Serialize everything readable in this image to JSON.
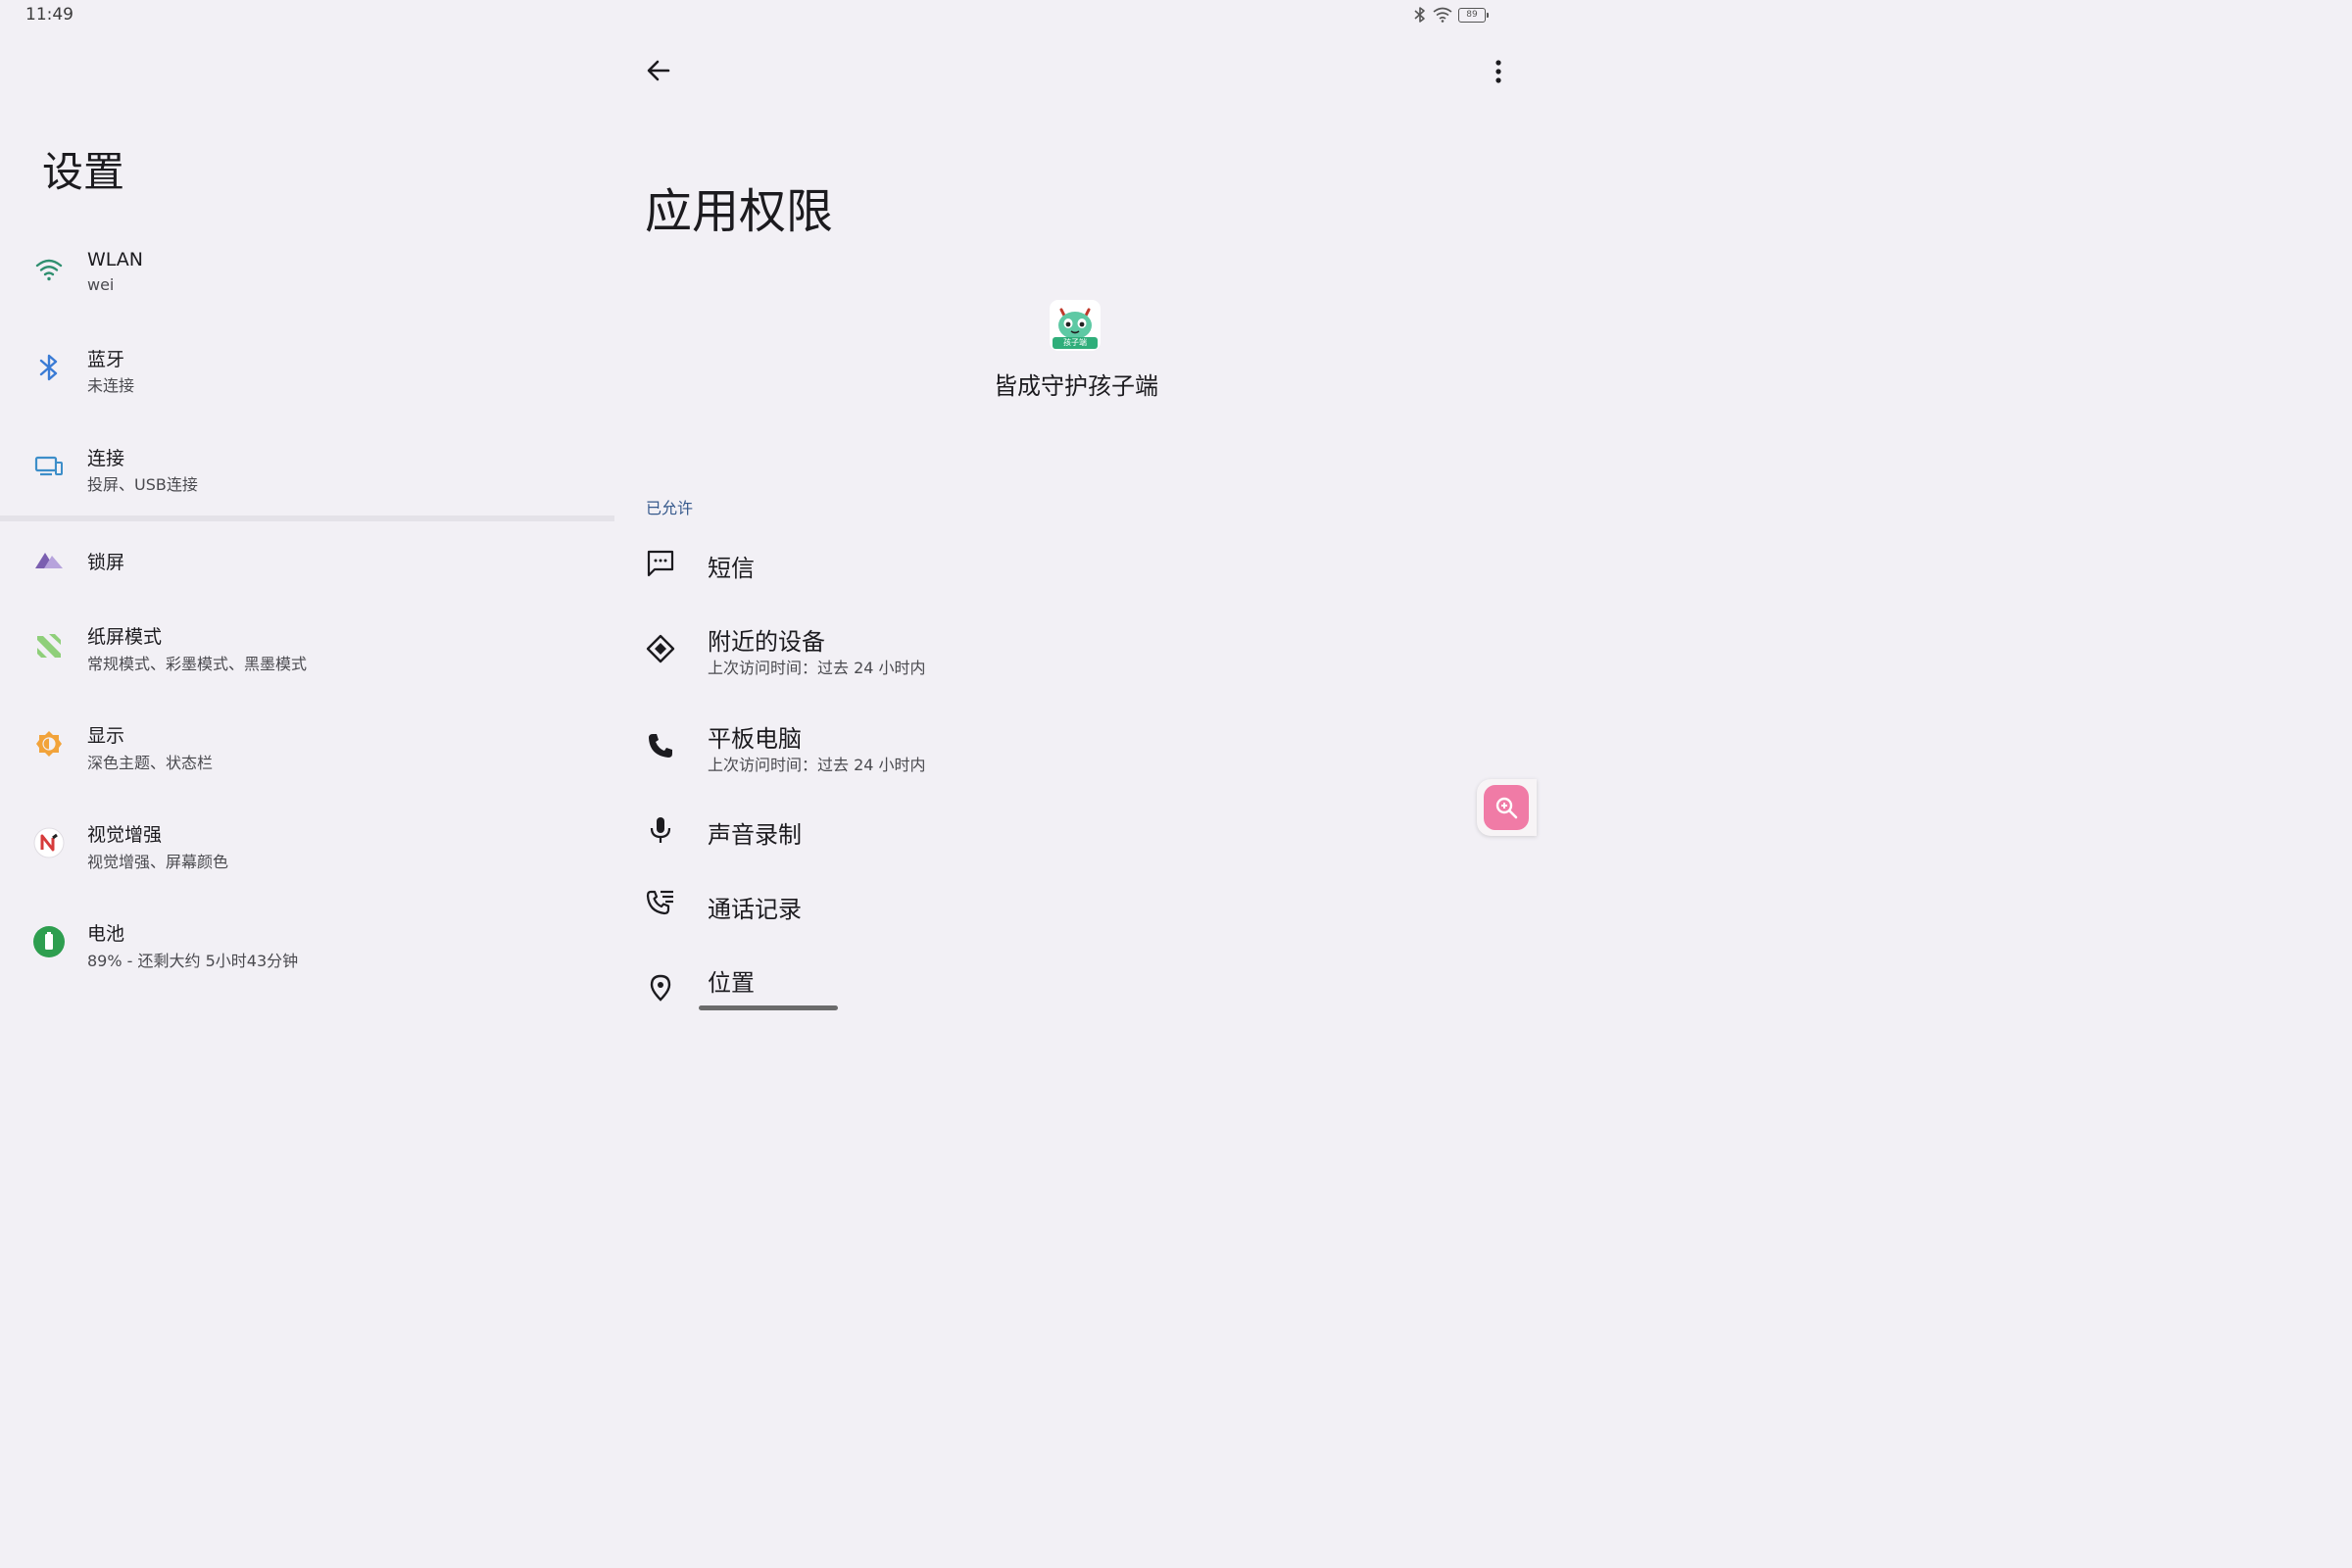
{
  "status_bar": {
    "time": "11:49",
    "battery_level": "89"
  },
  "settings": {
    "title": "设置",
    "items": [
      {
        "title": "WLAN",
        "subtitle": "wei",
        "icon": "wifi-icon"
      },
      {
        "title": "蓝牙",
        "subtitle": "未连接",
        "icon": "bluetooth-icon"
      },
      {
        "title": "连接",
        "subtitle": "投屏、USB连接",
        "icon": "devices-icon"
      },
      {
        "title": "锁屏",
        "subtitle": "",
        "icon": "lockscreen-icon"
      },
      {
        "title": "纸屏模式",
        "subtitle": "常规模式、彩墨模式、黑墨模式",
        "icon": "paper-mode-icon"
      },
      {
        "title": "显示",
        "subtitle": "深色主题、状态栏",
        "icon": "display-brightness-icon"
      },
      {
        "title": "视觉增强",
        "subtitle": "视觉增强、屏幕颜色",
        "icon": "visual-enhance-icon"
      },
      {
        "title": "电池",
        "subtitle": "89% - 还剩大约 5小时43分钟",
        "icon": "battery-icon"
      }
    ]
  },
  "app_permissions": {
    "title": "应用权限",
    "app_name": "皆成守护孩子端",
    "app_icon_label": "孩子端",
    "section_allowed": "已允许",
    "permissions": [
      {
        "title": "短信",
        "subtitle": "",
        "icon": "sms-icon"
      },
      {
        "title": "附近的设备",
        "subtitle": "上次访问时间：过去 24 小时内",
        "icon": "nearby-devices-icon"
      },
      {
        "title": "平板电脑",
        "subtitle": "上次访问时间：过去 24 小时内",
        "icon": "phone-icon"
      },
      {
        "title": "声音录制",
        "subtitle": "",
        "icon": "microphone-icon"
      },
      {
        "title": "通话记录",
        "subtitle": "",
        "icon": "call-log-icon"
      },
      {
        "title": "位置",
        "subtitle": "",
        "icon": "location-icon"
      }
    ]
  },
  "colors": {
    "accent": "#36598c",
    "fab": "#f07ba6",
    "background": "#f2f0f5"
  }
}
